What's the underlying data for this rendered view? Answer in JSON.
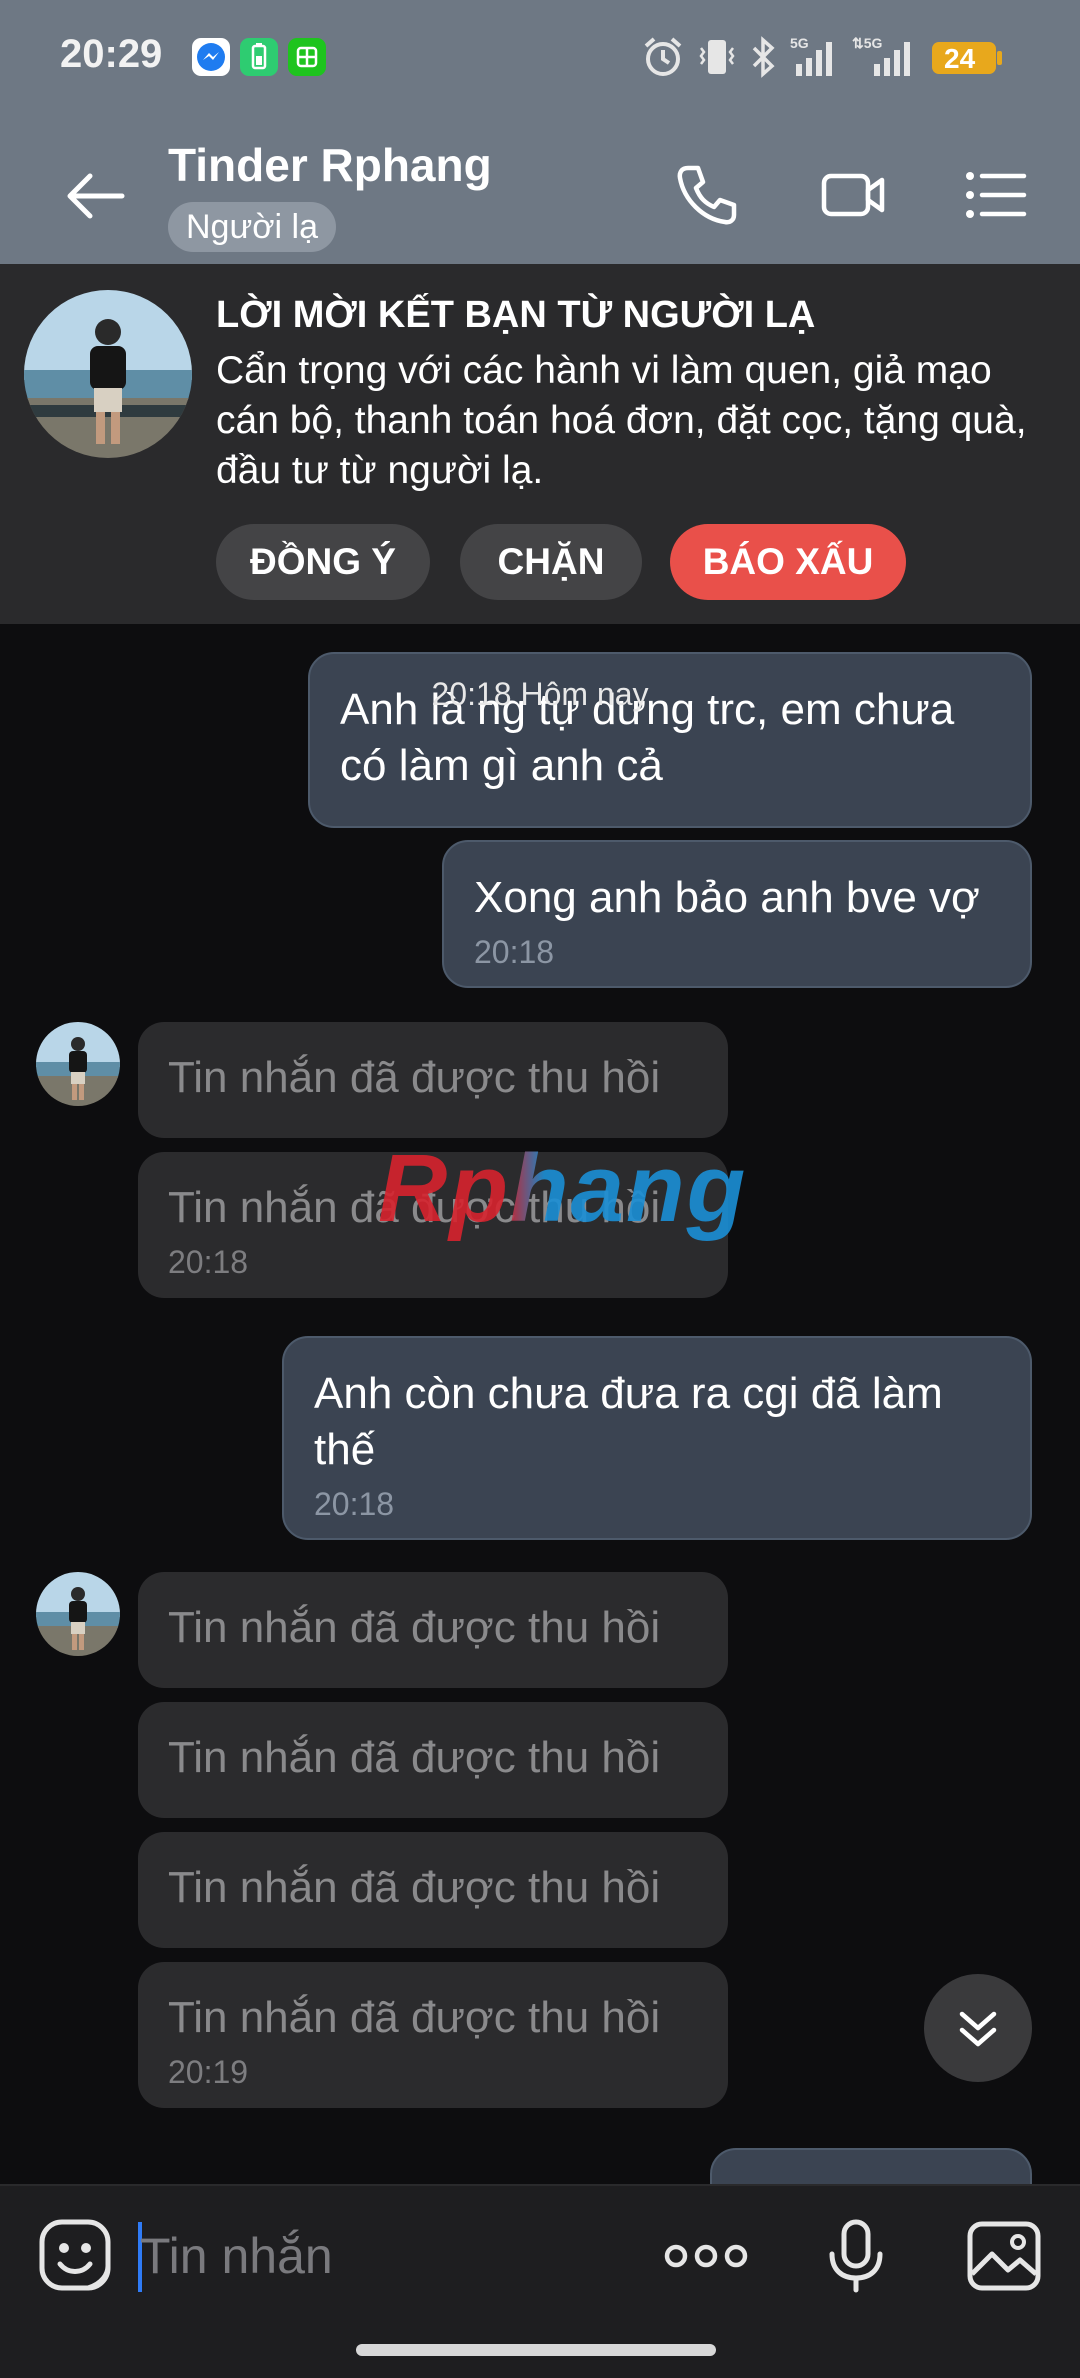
{
  "status_bar": {
    "time": "20:29",
    "battery": "24",
    "icons": [
      "messenger-icon",
      "battery-app-icon",
      "wechat-icon",
      "alarm-icon",
      "vibrate-icon",
      "bluetooth-icon",
      "signal-5g-icon",
      "signal-5g-icon",
      "battery-icon"
    ]
  },
  "header": {
    "title": "Tinder Rphang",
    "tag": "Người lạ",
    "icons": [
      "back-arrow-icon",
      "phone-call-icon",
      "video-call-icon",
      "menu-list-icon"
    ]
  },
  "friend_request": {
    "title": "LỜI MỜI KẾT BẠN TỪ NGƯỜI LẠ",
    "warning": "Cẩn trọng với các hành vi làm quen, giả mạo cán bộ, thanh toán hoá đơn, đặt cọc, tặng quà, đầu tư từ người lạ.",
    "accept_label": "ĐỒNG Ý",
    "block_label": "CHẶN",
    "report_label": "BÁO XẤU"
  },
  "chat": {
    "date_label": "20:18 Hôm nay",
    "watermark": "Rphang",
    "messages": [
      {
        "from": "me",
        "text": "Anh là ng tự dưng trc, em chưa có làm gì anh cả",
        "time": ""
      },
      {
        "from": "me",
        "text": "Xong anh bảo anh bve vợ",
        "time": "20:18"
      },
      {
        "from": "them",
        "text": "Tin nhắn đã được thu hồi",
        "time": ""
      },
      {
        "from": "them",
        "text": "Tin nhắn đã được thu hồi",
        "time": "20:18"
      },
      {
        "from": "me",
        "text": "Anh còn chưa đưa ra cgi đã làm thế",
        "time": "20:18"
      },
      {
        "from": "them",
        "text": "Tin nhắn đã được thu hồi",
        "time": ""
      },
      {
        "from": "them",
        "text": "Tin nhắn đã được thu hồi",
        "time": ""
      },
      {
        "from": "them",
        "text": "Tin nhắn đã được thu hồi",
        "time": ""
      },
      {
        "from": "them",
        "text": "Tin nhắn đã được thu hồi",
        "time": "20:19"
      }
    ]
  },
  "composer": {
    "placeholder": "Tin nhắn",
    "icons": [
      "sticker-icon",
      "more-dots-icon",
      "microphone-icon",
      "image-gallery-icon"
    ]
  },
  "colors": {
    "header_bg": "#6e7884",
    "report_red": "#e9504a",
    "my_bubble": "#3b4452",
    "their_bubble": "#2b2b2d"
  }
}
